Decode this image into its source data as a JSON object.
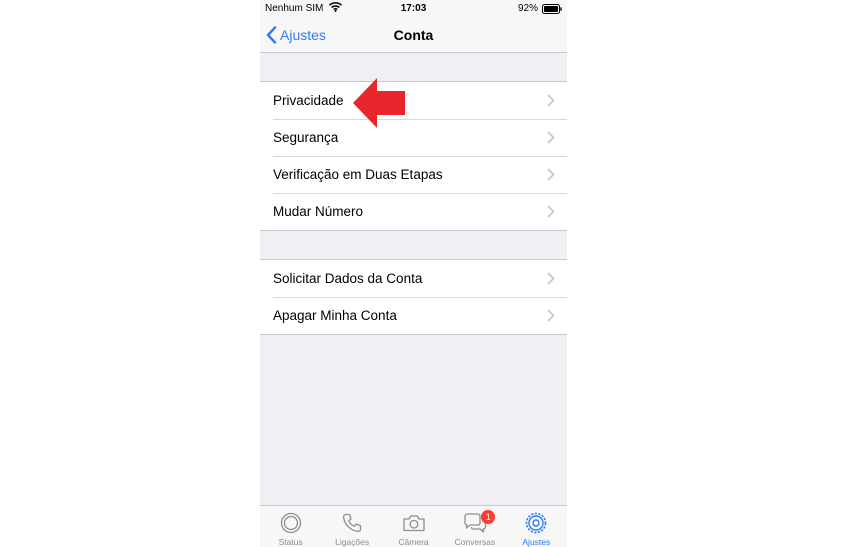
{
  "status_bar": {
    "carrier": "Nenhum SIM",
    "time": "17:03",
    "battery_percent": "92%",
    "icons": [
      "wifi-icon",
      "battery-icon"
    ]
  },
  "nav": {
    "back_label": "Ajustes",
    "title": "Conta"
  },
  "groups": [
    {
      "rows": [
        {
          "label": "Privacidade"
        },
        {
          "label": "Segurança"
        },
        {
          "label": "Verificação em Duas Etapas"
        },
        {
          "label": "Mudar Número"
        }
      ]
    },
    {
      "rows": [
        {
          "label": "Solicitar Dados da Conta"
        },
        {
          "label": "Apagar Minha Conta"
        }
      ]
    }
  ],
  "tab_bar": {
    "tabs": [
      {
        "label": "Status",
        "icon": "status-icon"
      },
      {
        "label": "Ligações",
        "icon": "phone-icon"
      },
      {
        "label": "Câmera",
        "icon": "camera-icon"
      },
      {
        "label": "Conversas",
        "icon": "chat-icon",
        "badge": "1"
      },
      {
        "label": "Ajustes",
        "icon": "settings-gear-icon",
        "active": true
      }
    ]
  },
  "colors": {
    "accent": "#2d7cf6",
    "background": "#efeff4",
    "badge": "#ff3b30",
    "annotation_arrow": "#e8262b"
  }
}
